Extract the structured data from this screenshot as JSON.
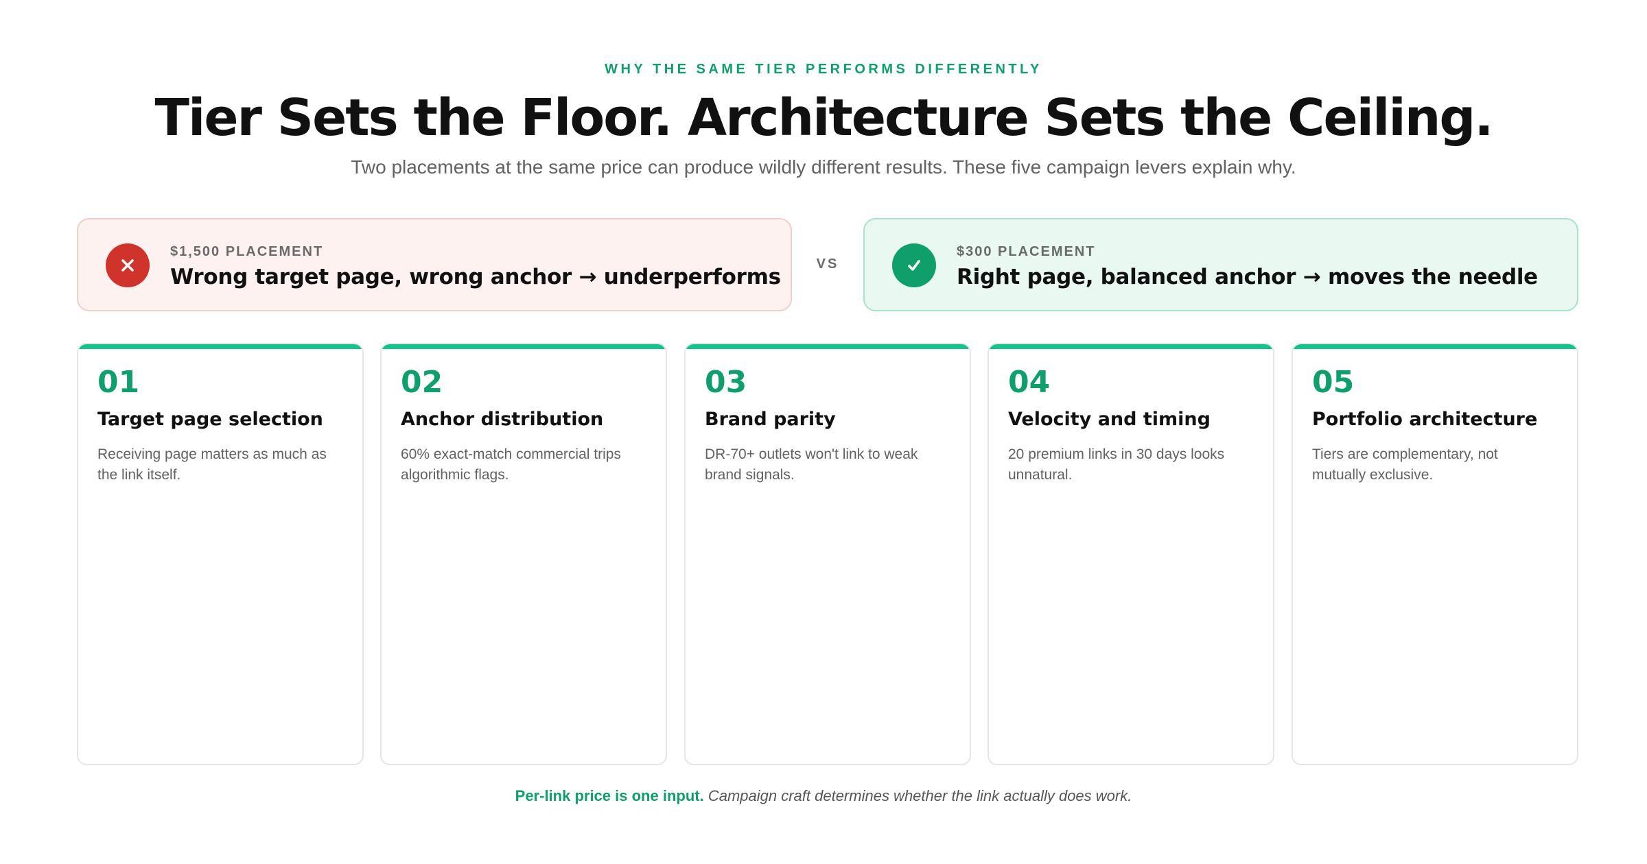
{
  "header": {
    "eyebrow": "WHY THE SAME TIER PERFORMS DIFFERENTLY",
    "title": "Tier Sets the Floor. Architecture Sets the Ceiling.",
    "subtitle": "Two placements at the same price can produce wildly different results. These five campaign levers explain why."
  },
  "comparison": {
    "bad": {
      "icon": "x-icon",
      "kicker": "$1,500 PLACEMENT",
      "headline": "Wrong target page, wrong anchor → underperforms",
      "color": "#cf3329"
    },
    "vs_label": "VS",
    "good": {
      "icon": "check-icon",
      "kicker": "$300 PLACEMENT",
      "headline": "Right page, balanced anchor → moves the needle",
      "color": "#0f9f6a"
    }
  },
  "levers": [
    {
      "num": "01",
      "title": "Target page selection",
      "desc": "Receiving page matters as much as the link itself."
    },
    {
      "num": "02",
      "title": "Anchor distribution",
      "desc": "60% exact-match commercial trips algorithmic flags."
    },
    {
      "num": "03",
      "title": "Brand parity",
      "desc": "DR-70+ outlets won't link to weak brand signals."
    },
    {
      "num": "04",
      "title": "Velocity and timing",
      "desc": "20 premium links in 30 days looks unnatural."
    },
    {
      "num": "05",
      "title": "Portfolio architecture",
      "desc": "Tiers are complementary, not mutually exclusive."
    }
  ],
  "footer": {
    "lead": "Per-link price is one input.",
    "rest": "Campaign craft determines whether the link actually does work."
  },
  "colors": {
    "accent": "#0f9f6a",
    "accent_bar": "#12c48a",
    "danger": "#cf3329"
  }
}
